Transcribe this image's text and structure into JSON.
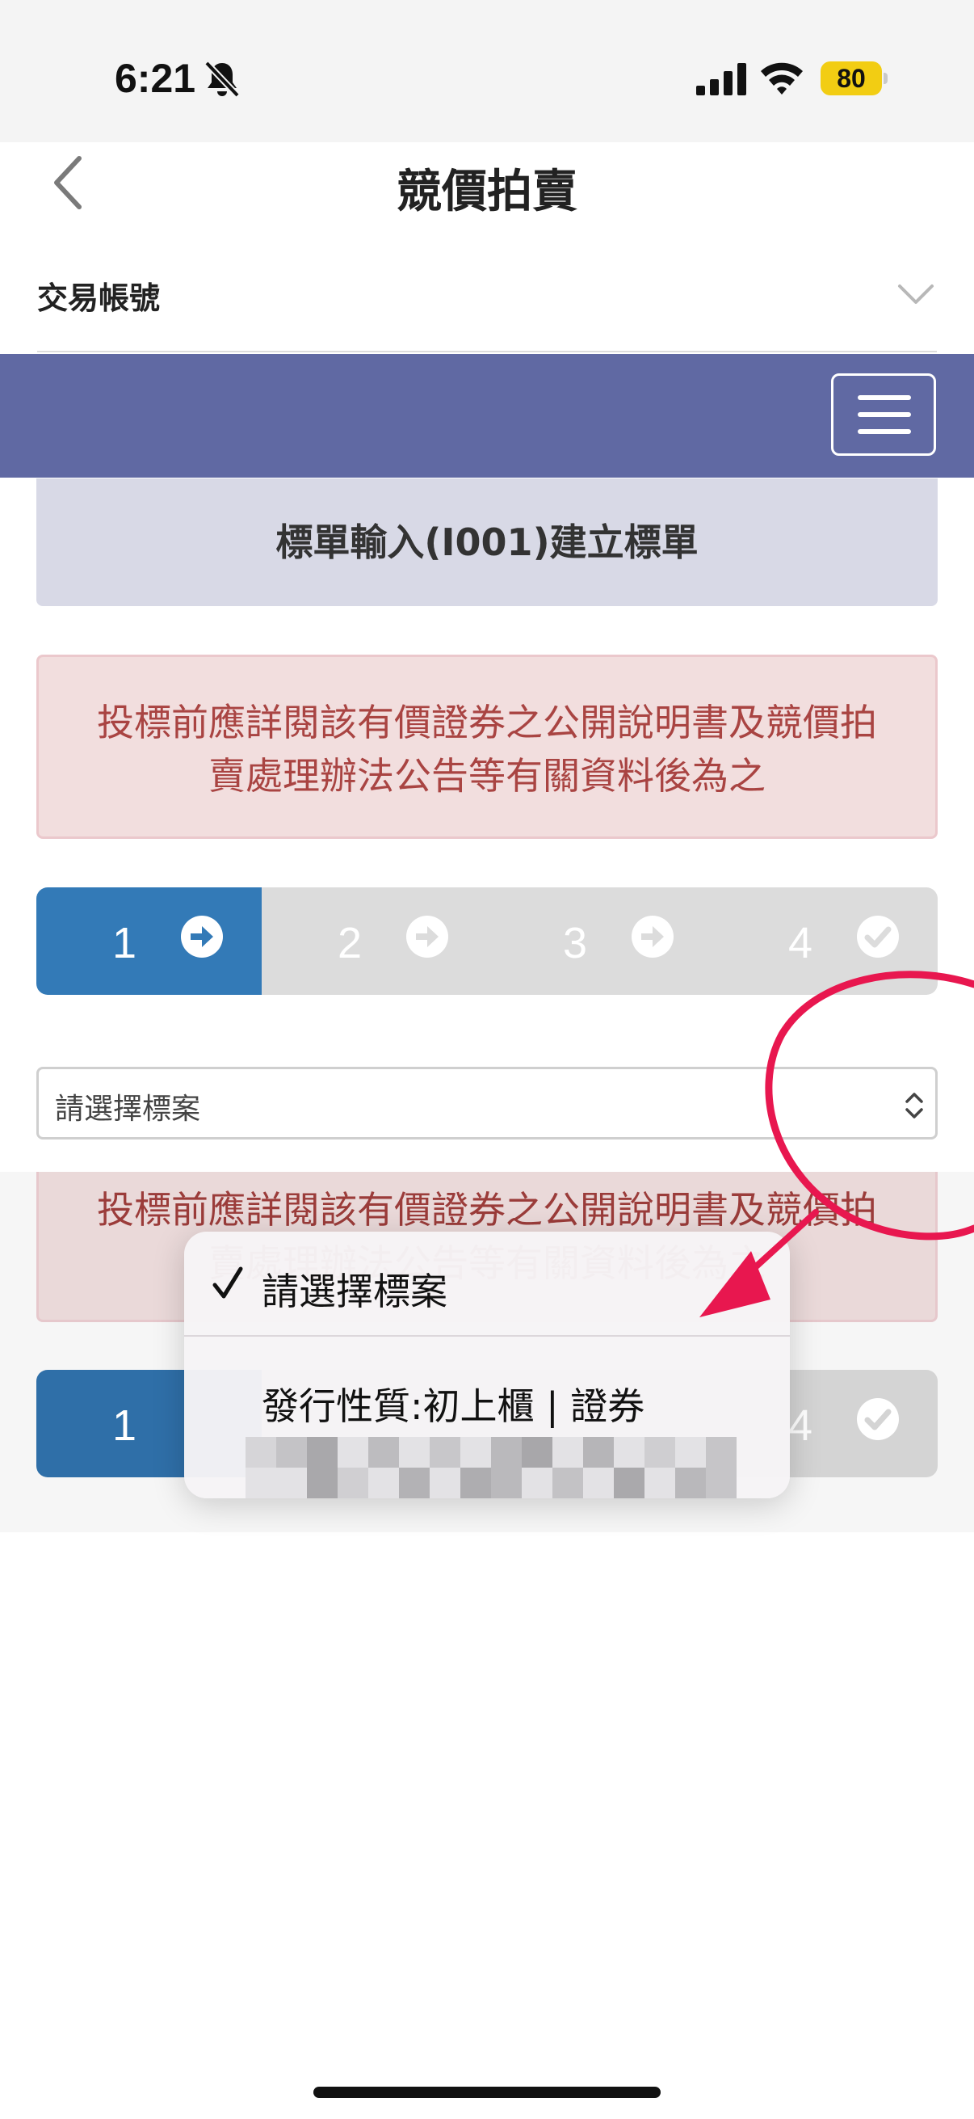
{
  "status_bar": {
    "time": "6:21",
    "battery": "80"
  },
  "nav": {
    "title": "競價拍賣",
    "back_icon": "chevron-left-icon"
  },
  "account": {
    "label": "交易帳號",
    "chevron_icon": "chevron-down-icon"
  },
  "menu": {
    "icon": "hamburger-icon"
  },
  "page_heading": "標單輸入(I001)建立標單",
  "alert": {
    "line1": "投標前應詳閱該有價證券之公開說明書及競價拍",
    "line2": "賣處理辦法公告等有關資料後為之"
  },
  "steps": [
    {
      "num": "1",
      "icon": "arrow-right-circle-icon",
      "state": "active"
    },
    {
      "num": "2",
      "icon": "arrow-right-circle-icon",
      "state": "inactive"
    },
    {
      "num": "3",
      "icon": "arrow-right-circle-icon",
      "state": "inactive"
    },
    {
      "num": "4",
      "icon": "check-circle-icon",
      "state": "inactive"
    }
  ],
  "select": {
    "value": "請選擇標案"
  },
  "dropdown": {
    "options": [
      {
        "label": "請選擇標案",
        "selected": true
      },
      {
        "label": "發行性質:初上櫃 | 證券"
      }
    ]
  },
  "colors": {
    "purple_bar": "#6069a3",
    "step_active": "#337ab7",
    "alert_text": "#a94442",
    "annotation": "#e8174f"
  }
}
